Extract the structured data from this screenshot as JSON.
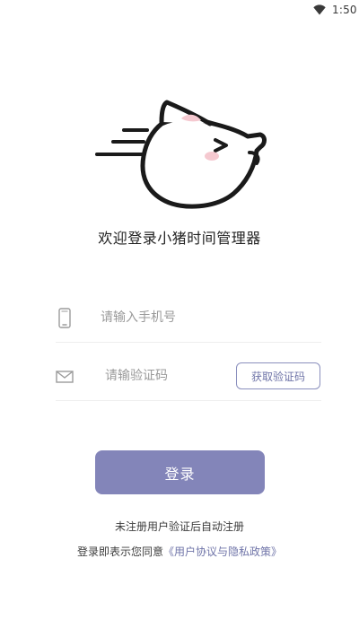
{
  "status_bar": {
    "time": "1:50",
    "wifi_icon": "wifi-icon"
  },
  "app": {
    "welcome_text": "欢迎登录小猪时间管理器",
    "logo_icon": "pig-logo-icon"
  },
  "phone_field": {
    "placeholder": "请输入手机号",
    "value": "",
    "icon": "phone-icon"
  },
  "code_field": {
    "placeholder": "请输验证码",
    "value": "",
    "icon": "mail-icon"
  },
  "get_code_button": {
    "label": "获取验证码"
  },
  "login_button": {
    "label": "登录"
  },
  "hint": {
    "text": "未注册用户验证后自动注册"
  },
  "agreement": {
    "prefix": "登录即表示您同意",
    "link": "《用户协议与隐私政策》"
  },
  "colors": {
    "accent": "#8385b9",
    "link": "#6f74a8",
    "pig_pink": "#f5c9d0"
  }
}
